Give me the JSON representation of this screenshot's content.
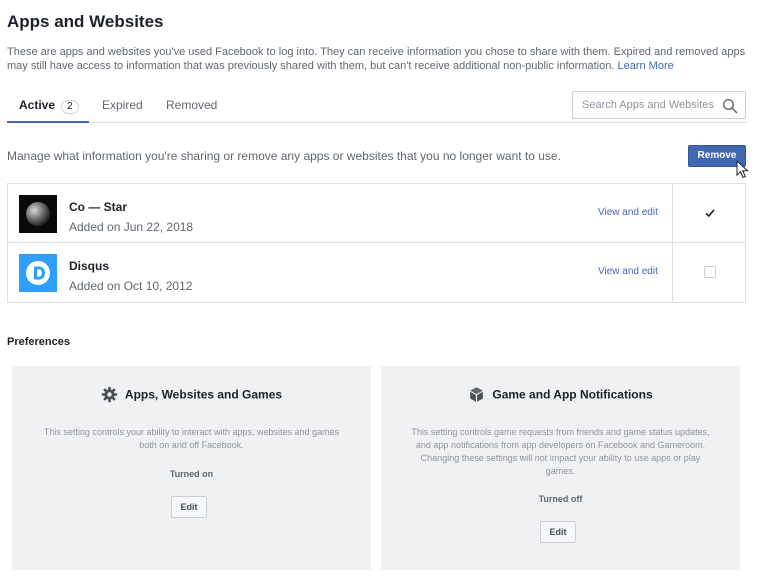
{
  "page": {
    "title": "Apps and Websites",
    "intro_text": "These are apps and websites you've used Facebook to log into. They can receive information you chose to share with them. Expired and removed apps may still have access to information that was previously shared with them, but can't receive additional non-public information.",
    "learn_more": "Learn More"
  },
  "tabs": [
    {
      "label": "Active",
      "count": "2",
      "active": true
    },
    {
      "label": "Expired"
    },
    {
      "label": "Removed"
    }
  ],
  "search": {
    "placeholder": "Search Apps and Websites"
  },
  "manage": {
    "text": "Manage what information you're sharing or remove any apps or websites that you no longer want to use.",
    "remove_label": "Remove"
  },
  "apps": [
    {
      "name": "Co — Star",
      "added": "Added on Jun 22, 2018",
      "view_edit": "View and edit",
      "checked": true,
      "icon": "co-star-icon"
    },
    {
      "name": "Disqus",
      "added": "Added on Oct 10, 2012",
      "view_edit": "View and edit",
      "checked": false,
      "icon": "disqus-icon"
    }
  ],
  "preferences": {
    "title": "Preferences",
    "cards": [
      {
        "title": "Apps, Websites and Games",
        "icon": "gear-icon",
        "description": "This setting controls your ability to interact with apps, websites and games both on and off Facebook.",
        "state": "Turned on",
        "edit_label": "Edit"
      },
      {
        "title": "Game and App Notifications",
        "icon": "cube-icon",
        "description": "This setting controls game requests from friends and game status updates, and app notifications from app developers on Facebook and Gameroom. Changing these settings will not impact your ability to use apps or play games.",
        "state": "Turned off",
        "edit_label": "Edit"
      }
    ]
  },
  "colors": {
    "accent": "#4267b2",
    "disqus": "#2e9fff"
  }
}
